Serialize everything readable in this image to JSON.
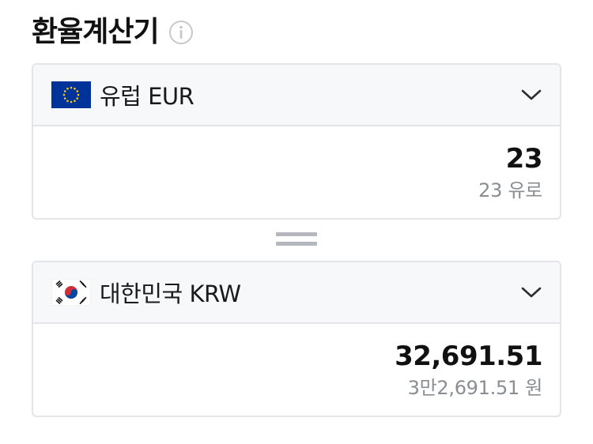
{
  "header": {
    "title": "환율계산기",
    "info_icon": "info-circle-icon"
  },
  "source": {
    "flag_icon": "eu-flag-icon",
    "currency_name": "유럽 EUR",
    "dropdown_icon": "chevron-down-icon",
    "amount": "23",
    "amount_words": "23 유로"
  },
  "equals_icon": "equals-icon",
  "target": {
    "flag_icon": "korea-flag-icon",
    "currency_name": "대한민국 KRW",
    "dropdown_icon": "chevron-down-icon",
    "amount": "32,691.51",
    "amount_words": "3만2,691.51 원"
  },
  "colors": {
    "border": "#e3e5e8",
    "selector_bg": "#f7f8fa",
    "secondary_text": "#8a8d92",
    "eu_blue": "#003399",
    "eu_gold": "#ffcc00",
    "korea_red": "#cd2e3a",
    "korea_blue": "#0047a0"
  }
}
